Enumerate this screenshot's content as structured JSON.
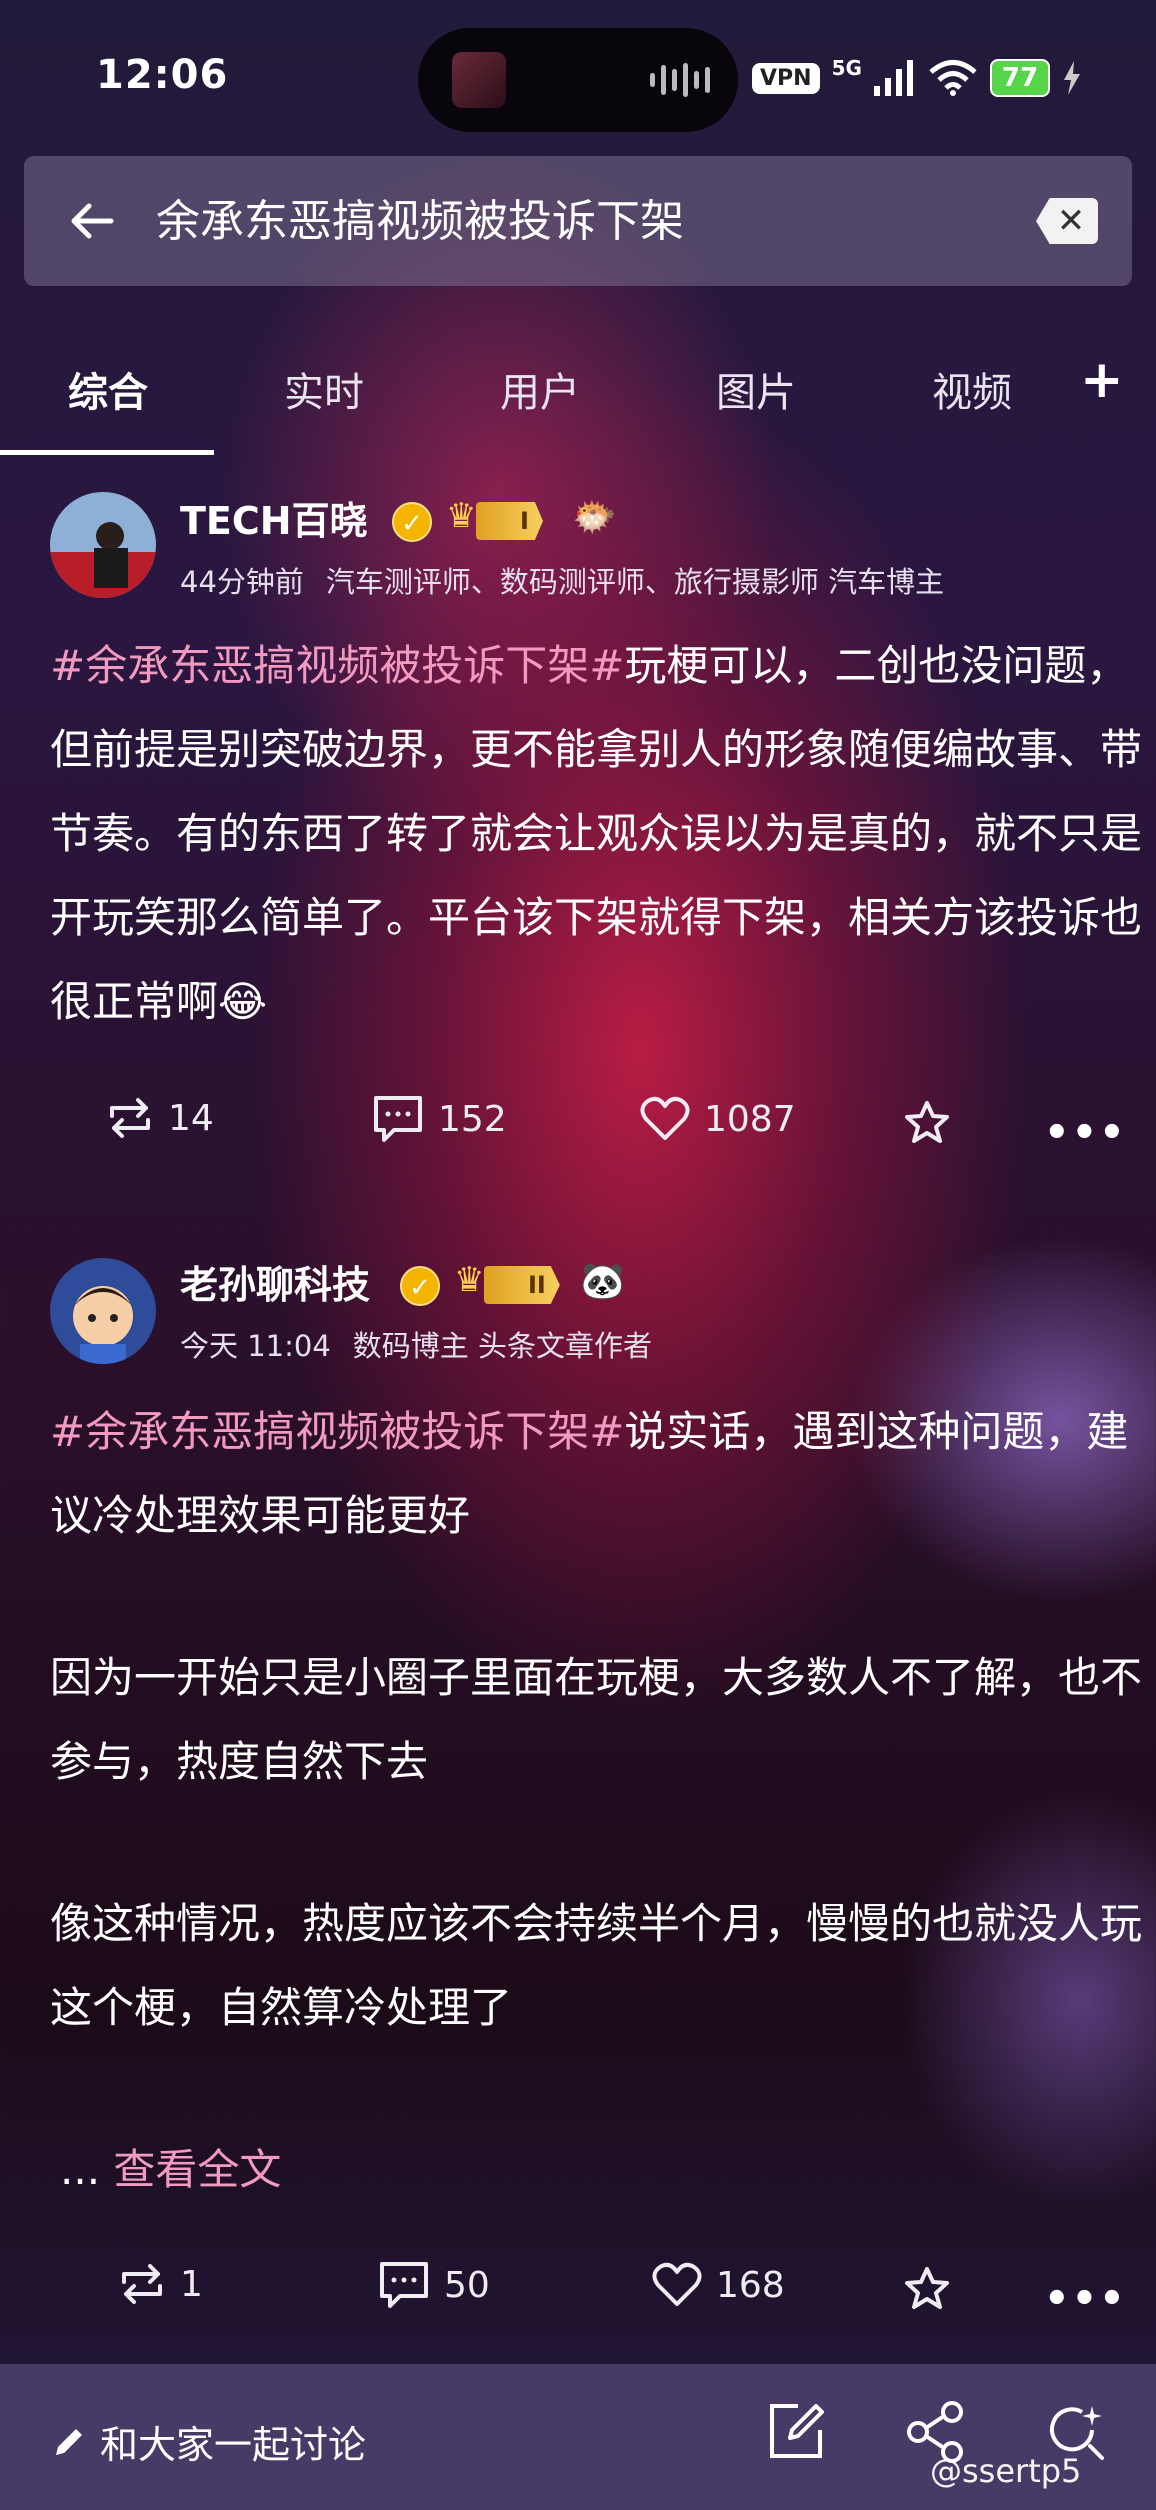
{
  "status_bar": {
    "time": "12:06",
    "vpn": "VPN",
    "network": "5G",
    "battery": "77"
  },
  "search": {
    "query": "余承东恶搞视频被投诉下架",
    "clear_icon": "clear-x-icon",
    "back_icon": "back-arrow-icon"
  },
  "tabs": [
    {
      "label": "综合",
      "active": true
    },
    {
      "label": "实时"
    },
    {
      "label": "用户"
    },
    {
      "label": "图片"
    },
    {
      "label": "视频"
    }
  ],
  "tab_add": "+",
  "posts": [
    {
      "username": "TECH百晓",
      "rank": "I",
      "time": "44分钟前",
      "description": "汽车测评师、数码测评师、旅行摄影师 汽车博主",
      "hashtag": "#余承东恶搞视频被投诉下架#",
      "text": "玩梗可以，二创也没问题，但前提是别突破边界，更不能拿别人的形象随便编故事、带节奏。有的东西了转了就会让观众误以为是真的，就不只是开玩笑那么简单了。平台该下架就得下架，相关方该投诉也很正常啊",
      "emoji": "😂",
      "reposts": "14",
      "comments": "152",
      "likes": "1087"
    },
    {
      "username": "老孙聊科技",
      "rank": "II",
      "time": "今天 11:04",
      "description": "数码博主 头条文章作者",
      "hashtag": "#余承东恶搞视频被投诉下架#",
      "text1": "说实话，遇到这种问题，建议冷处理效果可能更好",
      "text2": "因为一开始只是小圈子里面在玩梗，大多数人不了解，也不参与，热度自然下去",
      "text3": "像这种情况，热度应该不会持续半个月，慢慢的也就没人玩这个梗，自然算冷处理了",
      "read_more_prefix": "...",
      "read_more": "查看全文",
      "reposts": "1",
      "comments": "50",
      "likes": "168"
    }
  ],
  "bottom_bar": {
    "compose_label": "和大家一起讨论"
  },
  "watermark": "@ssertp5"
}
